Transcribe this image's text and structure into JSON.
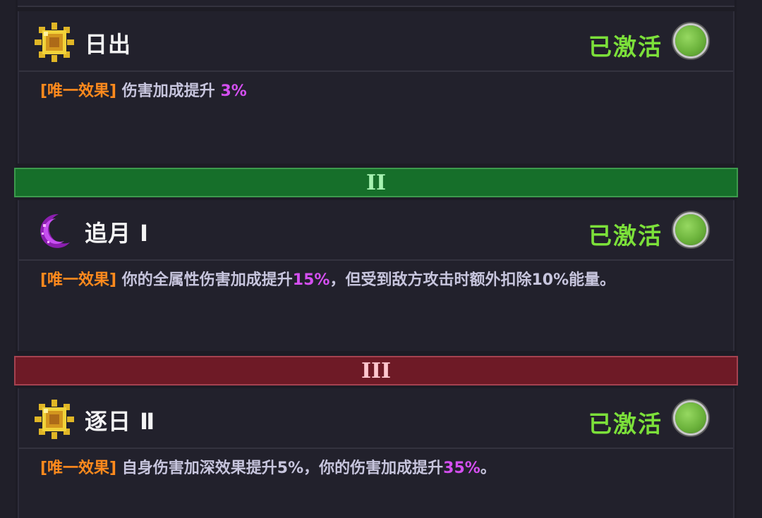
{
  "effects": [
    {
      "icon": "sun-icon",
      "title": "日出",
      "status": "已激活",
      "tag": "[唯一效果]",
      "text_a": " 伤害加成提升 ",
      "hl_a": "3%",
      "text_b": "",
      "hl_b": "",
      "text_c": ""
    },
    {
      "icon": "crescent-moon-icon",
      "title": "追月 Ⅰ",
      "status": "已激活",
      "tag": "[唯一效果]",
      "text_a": " 你的全属性伤害加成提升",
      "hl_a": "15%",
      "text_b": "，但受到敌方攻击时额外扣除10%能量。",
      "hl_b": "",
      "text_c": ""
    },
    {
      "icon": "sun-icon",
      "title": "逐日 Ⅱ",
      "status": "已激活",
      "tag": "[唯一效果]",
      "text_a": " 自身伤害加深效果提升5%，你的伤害加成提升",
      "hl_a": "35%",
      "text_b": "。",
      "hl_b": "",
      "text_c": ""
    }
  ],
  "tiers": [
    {
      "label": "II",
      "color": "#166f2a"
    },
    {
      "label": "III",
      "color": "#6e1a26"
    }
  ],
  "colors": {
    "active": "#7ce03a",
    "tag": "#ff8a1d",
    "highlight": "#d44ff0",
    "text": "#c7c5dd"
  }
}
